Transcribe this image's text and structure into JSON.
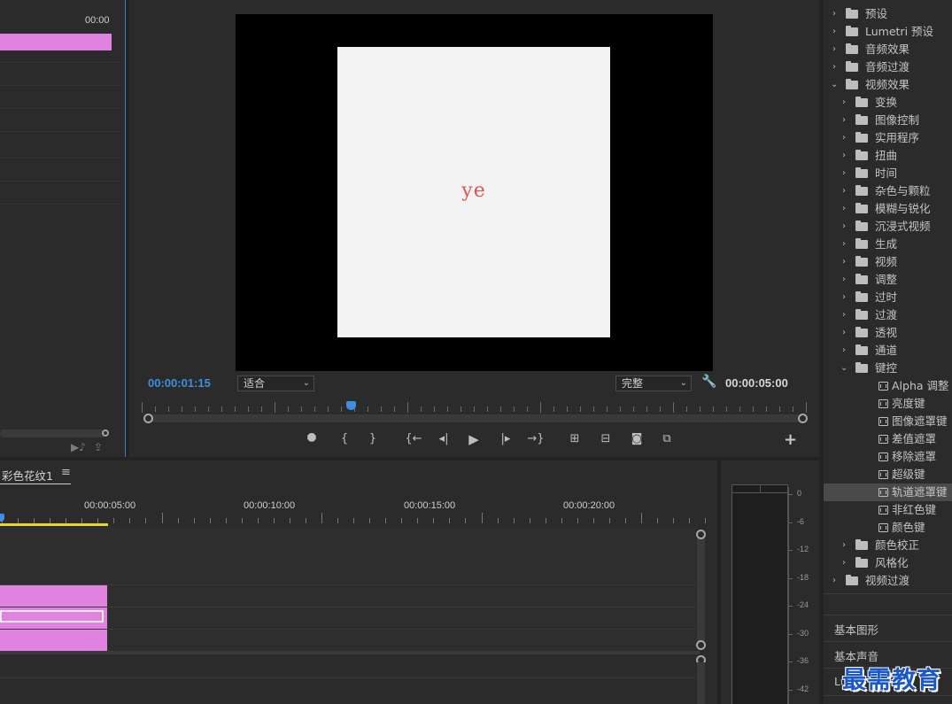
{
  "source": {
    "timecode_fragment": "00:00"
  },
  "program": {
    "current_time": "00:00:01:15",
    "fit_label": "适合",
    "quality_label": "完整",
    "duration": "00:00:05:00",
    "frame_text": "ye",
    "playhead_fraction": 0.315,
    "controls": [
      {
        "name": "add-marker-button",
        "glyph": "⯃"
      },
      {
        "name": "mark-in-button",
        "glyph": "{"
      },
      {
        "name": "mark-out-button",
        "glyph": "}"
      },
      {
        "name": "go-to-in-button",
        "glyph": "{←"
      },
      {
        "name": "step-back-button",
        "glyph": "◂|"
      },
      {
        "name": "play-button",
        "glyph": "▶"
      },
      {
        "name": "step-forward-button",
        "glyph": "|▸"
      },
      {
        "name": "go-to-out-button",
        "glyph": "→}"
      },
      {
        "name": "lift-button",
        "glyph": "⊞"
      },
      {
        "name": "extract-button",
        "glyph": "⊟"
      },
      {
        "name": "export-frame-button",
        "glyph": "◙"
      },
      {
        "name": "compare-view-button",
        "glyph": "⧉"
      }
    ],
    "add_glyph": "+"
  },
  "effects": {
    "items": [
      {
        "label": "预设",
        "level": 0,
        "chevron": "›",
        "icon": "folder-preset"
      },
      {
        "label": "Lumetri 预设",
        "level": 0,
        "chevron": "›",
        "icon": "folder-preset"
      },
      {
        "label": "音频效果",
        "level": 0,
        "chevron": "›",
        "icon": "folder"
      },
      {
        "label": "音频过渡",
        "level": 0,
        "chevron": "›",
        "icon": "folder"
      },
      {
        "label": "视频效果",
        "level": 0,
        "chevron": "⌄",
        "icon": "folder"
      },
      {
        "label": "变换",
        "level": 1,
        "chevron": "›",
        "icon": "folder"
      },
      {
        "label": "图像控制",
        "level": 1,
        "chevron": "›",
        "icon": "folder"
      },
      {
        "label": "实用程序",
        "level": 1,
        "chevron": "›",
        "icon": "folder"
      },
      {
        "label": "扭曲",
        "level": 1,
        "chevron": "›",
        "icon": "folder"
      },
      {
        "label": "时间",
        "level": 1,
        "chevron": "›",
        "icon": "folder"
      },
      {
        "label": "杂色与颗粒",
        "level": 1,
        "chevron": "›",
        "icon": "folder"
      },
      {
        "label": "模糊与锐化",
        "level": 1,
        "chevron": "›",
        "icon": "folder"
      },
      {
        "label": "沉浸式视频",
        "level": 1,
        "chevron": "›",
        "icon": "folder"
      },
      {
        "label": "生成",
        "level": 1,
        "chevron": "›",
        "icon": "folder"
      },
      {
        "label": "视频",
        "level": 1,
        "chevron": "›",
        "icon": "folder"
      },
      {
        "label": "调整",
        "level": 1,
        "chevron": "›",
        "icon": "folder"
      },
      {
        "label": "过时",
        "level": 1,
        "chevron": "›",
        "icon": "folder"
      },
      {
        "label": "过渡",
        "level": 1,
        "chevron": "›",
        "icon": "folder"
      },
      {
        "label": "透视",
        "level": 1,
        "chevron": "›",
        "icon": "folder"
      },
      {
        "label": "通道",
        "level": 1,
        "chevron": "›",
        "icon": "folder"
      },
      {
        "label": "键控",
        "level": 1,
        "chevron": "⌄",
        "icon": "folder"
      },
      {
        "label": "Alpha 调整",
        "level": 2,
        "chevron": "",
        "icon": "effect"
      },
      {
        "label": "亮度键",
        "level": 2,
        "chevron": "",
        "icon": "effect"
      },
      {
        "label": "图像遮罩键",
        "level": 2,
        "chevron": "",
        "icon": "effect"
      },
      {
        "label": "差值遮罩",
        "level": 2,
        "chevron": "",
        "icon": "effect"
      },
      {
        "label": "移除遮罩",
        "level": 2,
        "chevron": "",
        "icon": "effect"
      },
      {
        "label": "超级键",
        "level": 2,
        "chevron": "",
        "icon": "effect"
      },
      {
        "label": "轨道遮罩键",
        "level": 2,
        "chevron": "",
        "icon": "effect",
        "selected": true
      },
      {
        "label": "非红色键",
        "level": 2,
        "chevron": "",
        "icon": "effect"
      },
      {
        "label": "颜色键",
        "level": 2,
        "chevron": "",
        "icon": "effect"
      },
      {
        "label": "颜色校正",
        "level": 1,
        "chevron": "›",
        "icon": "folder"
      },
      {
        "label": "风格化",
        "level": 1,
        "chevron": "›",
        "icon": "folder"
      },
      {
        "label": "视频过渡",
        "level": 0,
        "chevron": "›",
        "icon": "folder"
      }
    ],
    "bottom_panels": [
      "基本图形",
      "基本声音"
    ],
    "partial_panel": "Lu"
  },
  "timeline": {
    "tab_label": "彩色花纹1",
    "menu_glyph": "≡",
    "ruler_labels": [
      "00:00:05:00",
      "00:00:10:00",
      "00:00:15:00",
      "00:00:20:00"
    ]
  },
  "meter": {
    "scale": [
      "0",
      "-6",
      "-12",
      "-18",
      "-24",
      "-30",
      "-36",
      "-42"
    ]
  },
  "watermark": "最需教育",
  "colors": {
    "accent_blue": "#3d8ee0",
    "clip_pink": "#e083e0",
    "work_area_yellow": "#e8d42a",
    "frame_text_red": "#e05454"
  }
}
